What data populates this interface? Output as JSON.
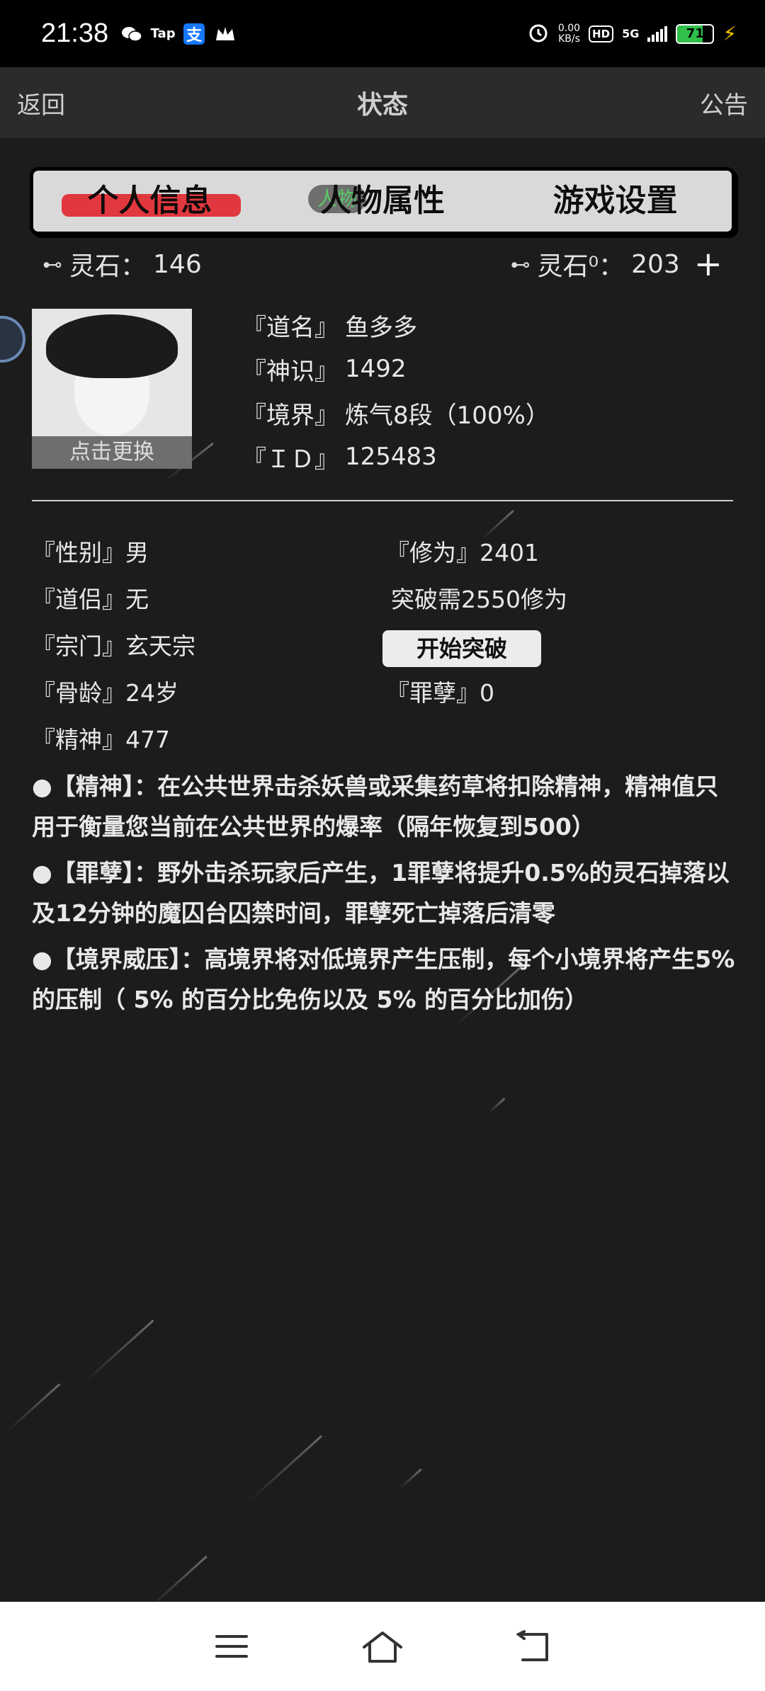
{
  "status_bar": {
    "time": "21:38",
    "left_icons": [
      "wechat-icon",
      "taptap-icon",
      "alipay-icon",
      "crown-icon"
    ],
    "taptap_text": "Tap",
    "alipay_text": "支",
    "net_speed_value": "0.00",
    "net_speed_unit": "KB/s",
    "hd": "HD",
    "network": "5G",
    "battery": "71",
    "battery_level": 0.71,
    "battery_color": "#2fbf4a"
  },
  "nav": {
    "back": "返回",
    "title": "状态",
    "notice": "公告"
  },
  "tabs": [
    {
      "label": "个人信息",
      "active": true
    },
    {
      "label": "人物属性",
      "active": false
    },
    {
      "label": "游戏设置",
      "active": false
    }
  ],
  "tab_pill_text": "人物",
  "currency": {
    "left_label": "灵石：",
    "left_value": "146",
    "right_label": "灵石⁰：",
    "right_value": "203",
    "plus": "+"
  },
  "avatar": {
    "change_label": "点击更换"
  },
  "profile": [
    {
      "key": "『道名』",
      "value": "鱼多多"
    },
    {
      "key": "『神识』",
      "value": "1492"
    },
    {
      "key": "『境界』",
      "value": "炼气8段（100%）"
    },
    {
      "key": "『ＩＤ』",
      "value": "125483"
    }
  ],
  "attributes_left": [
    "『性别』男",
    "『道侣』无",
    "『宗门』玄天宗",
    "『骨龄』24岁",
    "『精神』477"
  ],
  "attributes_right": {
    "cultivation": "『修为』2401",
    "breakthrough_need": "突破需2550修为",
    "breakthrough_button": "开始突破",
    "sin": "『罪孽』0"
  },
  "notes": [
    "●【精神】：在公共世界击杀妖兽或采集药草将扣除精神，精神值只用于衡量您当前在公共世界的爆率（隔年恢复到500）",
    "●【罪孽】：野外击杀玩家后产生，1罪孽将提升0.5%的灵石掉落以及12分钟的魔囚台囚禁时间，罪孽死亡掉落后清零",
    "●【境界威压】：高境界将对低境界产生压制，每个小境界将产生5% 的压制（ 5% 的百分比免伤以及 5% 的百分比加伤）"
  ],
  "colors": {
    "background": "#1c1c1c",
    "nav_bg": "#2b2b2b",
    "tab_active_highlight": "#e0383e",
    "tab_panel": "#d9d9d9",
    "tab_pill_text": "#3ac44a"
  },
  "bottom_nav": [
    "menu-icon",
    "home-icon",
    "back-icon"
  ]
}
